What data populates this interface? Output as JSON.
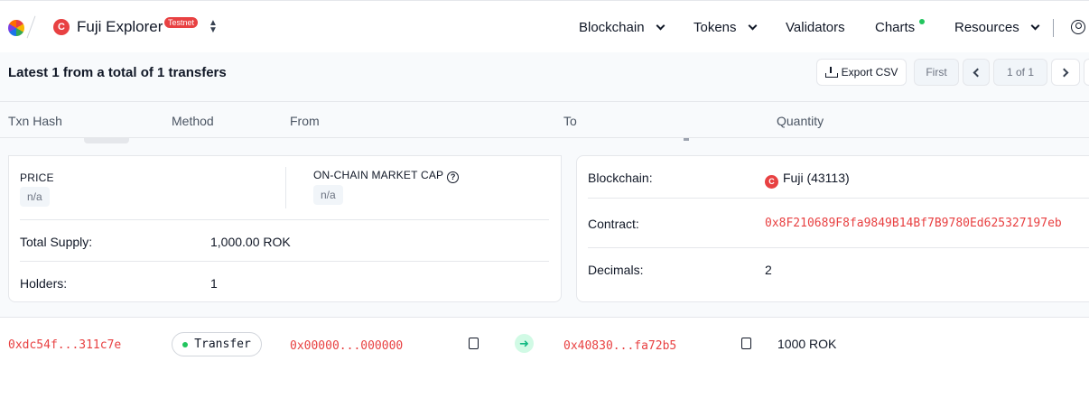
{
  "header": {
    "brand": "Fuji Explorer",
    "badge": "Testnet",
    "chain_icon": "C",
    "switcher_icon": "▲▼",
    "nav": {
      "blockchain": "Blockchain",
      "tokens": "Tokens",
      "validators": "Validators",
      "charts": "Charts",
      "resources": "Resources"
    }
  },
  "toolbar": {
    "summary": "Latest 1 from a total of 1 transfers",
    "export": "Export CSV",
    "first": "First",
    "page": "1 of 1"
  },
  "table": {
    "columns": {
      "txn_hash": "Txn Hash",
      "method": "Method",
      "from": "From",
      "to": "To",
      "quantity": "Quantity"
    }
  },
  "token_panel": {
    "price_label": "PRICE",
    "price_value": "n/a",
    "market_cap_label": "ON-CHAIN MARKET CAP",
    "market_cap_help": "?",
    "market_cap_value": "n/a",
    "total_supply_label": "Total Supply:",
    "total_supply_value": "1,000.00 ROK",
    "holders_label": "Holders:",
    "holders_value": "1",
    "blockchain_label": "Blockchain:",
    "blockchain_icon": "C",
    "blockchain_value": "Fuji (43113)",
    "contract_label": "Contract:",
    "contract_value": "0x8F210689F8fa9849B14Bf7B9780Ed625327197eb",
    "decimals_label": "Decimals:",
    "decimals_value": "2"
  },
  "row": {
    "txn_hash": "0xdc54f...311c7e",
    "method": "Transfer",
    "from": "0x00000...000000",
    "to": "0x40830...fa72b5",
    "quantity": "1000 ROK",
    "arrow": "➜"
  },
  "colors": {
    "accent_red": "#e84142",
    "success_green": "#22c55e"
  }
}
